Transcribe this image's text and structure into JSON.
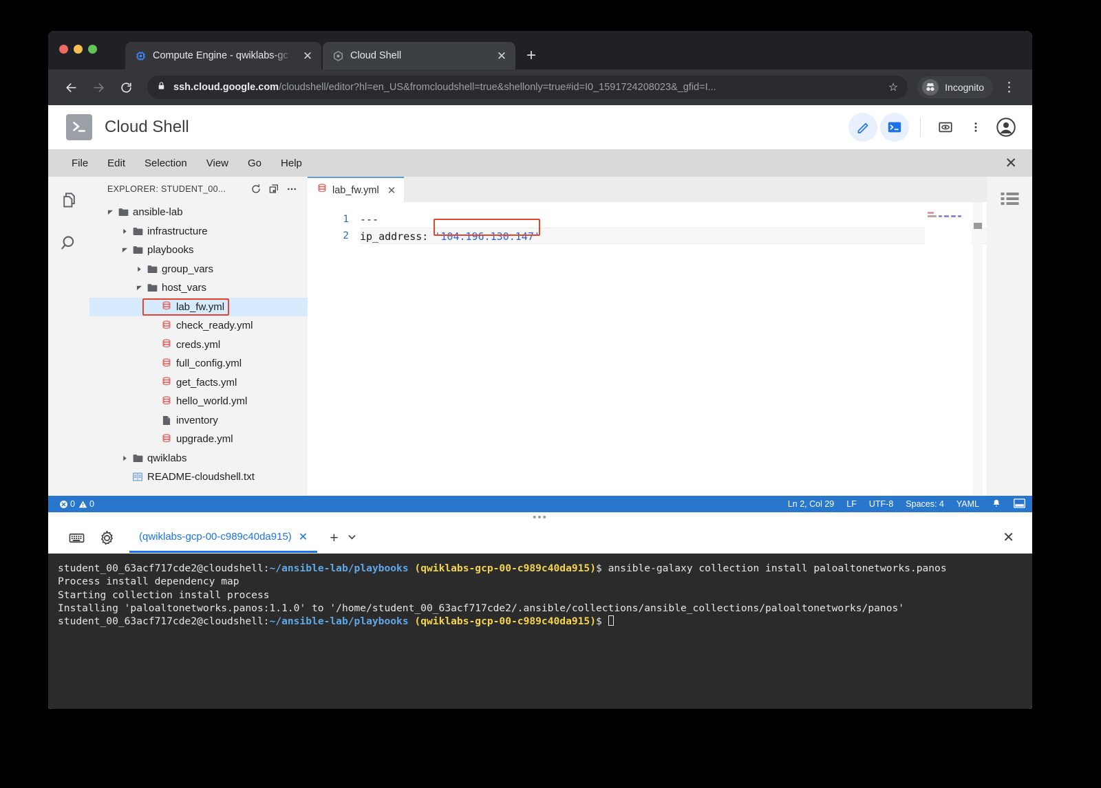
{
  "browser": {
    "tabs": [
      {
        "title": "Compute Engine - qwiklabs-gc",
        "favicon": "compute-engine-icon",
        "active": false
      },
      {
        "title": "Cloud Shell",
        "favicon": "cloud-shell-icon",
        "active": true
      }
    ],
    "new_tab_label": "+",
    "close_label": "✕",
    "back_label": "←",
    "forward_label": "→",
    "reload_label": "↻",
    "url_domain": "ssh.cloud.google.com",
    "url_path": "/cloudshell/editor?hl=en_US&fromcloudshell=true&shellonly=true#id=I0_1591724208023&_gfid=I...",
    "star_label": "☆",
    "incognito_label": "Incognito",
    "menu_label": "⋮"
  },
  "cloudshell": {
    "app_title": "Cloud Shell",
    "logo_icon": "cloud-shell-logo",
    "header_buttons": [
      {
        "name": "open-editor-button",
        "icon": "pencil-icon"
      },
      {
        "name": "open-terminal-button",
        "icon": "terminal-icon"
      },
      {
        "name": "web-preview-button",
        "icon": "web-preview-icon"
      },
      {
        "name": "more-options-button",
        "icon": "more-vert-icon"
      },
      {
        "name": "account-button",
        "icon": "account-circle-icon"
      }
    ],
    "menu_items": [
      "File",
      "Edit",
      "Selection",
      "View",
      "Go",
      "Help"
    ],
    "menubar_close_label": "✕"
  },
  "activity_bar": {
    "items": [
      {
        "name": "explorer-icon",
        "label": "explorer"
      },
      {
        "name": "search-icon",
        "label": "search"
      }
    ]
  },
  "explorer": {
    "title": "EXPLORER: STUDENT_00...",
    "actions": [
      {
        "name": "refresh-icon",
        "glyph": "↻"
      },
      {
        "name": "new-file-icon",
        "glyph": "⧉"
      },
      {
        "name": "more-actions-icon",
        "glyph": "⋯"
      }
    ],
    "tree": [
      {
        "label": "ansible-lab",
        "type": "folder",
        "depth": 0,
        "expanded": true,
        "selected": false
      },
      {
        "label": "infrastructure",
        "type": "folder",
        "depth": 1,
        "expanded": false,
        "selected": false
      },
      {
        "label": "playbooks",
        "type": "folder",
        "depth": 1,
        "expanded": true,
        "selected": false
      },
      {
        "label": "group_vars",
        "type": "folder",
        "depth": 2,
        "expanded": false,
        "selected": false
      },
      {
        "label": "host_vars",
        "type": "folder",
        "depth": 2,
        "expanded": true,
        "selected": false
      },
      {
        "label": "lab_fw.yml",
        "type": "yaml",
        "depth": 3,
        "expanded": null,
        "selected": true,
        "highlighted": true
      },
      {
        "label": "check_ready.yml",
        "type": "yaml",
        "depth": 3,
        "expanded": null,
        "selected": false
      },
      {
        "label": "creds.yml",
        "type": "yaml",
        "depth": 3,
        "expanded": null,
        "selected": false
      },
      {
        "label": "full_config.yml",
        "type": "yaml",
        "depth": 3,
        "expanded": null,
        "selected": false
      },
      {
        "label": "get_facts.yml",
        "type": "yaml",
        "depth": 3,
        "expanded": null,
        "selected": false
      },
      {
        "label": "hello_world.yml",
        "type": "yaml",
        "depth": 3,
        "expanded": null,
        "selected": false
      },
      {
        "label": "inventory",
        "type": "file",
        "depth": 3,
        "expanded": null,
        "selected": false
      },
      {
        "label": "upgrade.yml",
        "type": "yaml",
        "depth": 3,
        "expanded": null,
        "selected": false
      },
      {
        "label": "qwiklabs",
        "type": "folder",
        "depth": 1,
        "expanded": false,
        "selected": false
      },
      {
        "label": "README-cloudshell.txt",
        "type": "text",
        "depth": 1,
        "expanded": null,
        "selected": false
      }
    ]
  },
  "editor": {
    "tab_label": "lab_fw.yml",
    "tab_icon": "yaml-file-icon",
    "tab_close_label": "✕",
    "lines": [
      {
        "number": "1",
        "text": "---",
        "current": false
      },
      {
        "number": "2",
        "text": "ip_address: '104.196.130.147'",
        "current": true
      }
    ],
    "line2_key": "ip_address: ",
    "line2_value": "'104.196.130.147'",
    "highlight_color": "#e8442a",
    "outline_icon": "outline-list-icon"
  },
  "statusbar": {
    "error_icon": "error-icon",
    "error_count": "0",
    "warning_icon": "warning-icon",
    "warning_count": "0",
    "cursor_position": "Ln 2, Col 29",
    "line_ending": "LF",
    "encoding": "UTF-8",
    "indentation": "Spaces: 4",
    "language": "YAML",
    "bell_icon": "bell-icon",
    "panel_icon": "panel-toggle-icon"
  },
  "terminal": {
    "drag_handle": "•••",
    "toolbar": [
      {
        "name": "keyboard-icon",
        "glyph": "keyboard"
      },
      {
        "name": "settings-gear-icon",
        "glyph": "gear"
      }
    ],
    "tab_label": "(qwiklabs-gcp-00-c989c40da915)",
    "tab_close_label": "✕",
    "add_tab_label": "+",
    "dropdown_label": "▼",
    "close_label": "✕",
    "prompt_user": "student_00_63acf717cde2@cloudshell:",
    "prompt_path": "~/ansible-lab/playbooks",
    "prompt_project": "(qwiklabs-gcp-00-c989c40da915)",
    "prompt_sigil": "$ ",
    "command": "ansible-galaxy collection install paloaltonetworks.panos",
    "output_lines": [
      "Process install dependency map",
      "Starting collection install process",
      "Installing 'paloaltonetworks.panos:1.1.0' to '/home/student_00_63acf717cde2/.ansible/collections/ansible_collections/paloaltonetworks/panos'"
    ]
  }
}
